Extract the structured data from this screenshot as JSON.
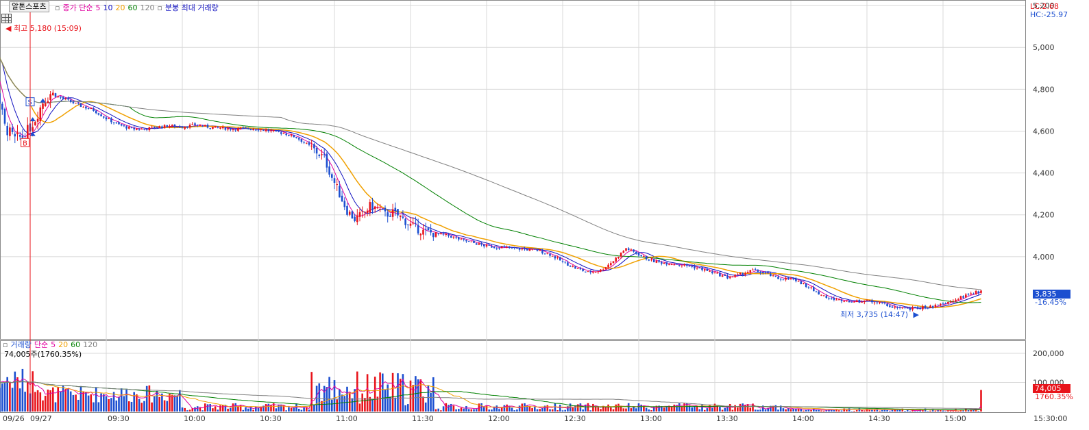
{
  "window": {
    "stock_tab": "알톤스포츠",
    "lc_label": "LC:2.68",
    "hc_label": "HC:-25.97"
  },
  "price_legend": {
    "marker": "▫",
    "label": "종가 단순",
    "periods": [
      "5",
      "10",
      "20",
      "60",
      "120"
    ],
    "period_colors": [
      "#e000a0",
      "#1010c0",
      "#f0a000",
      "#008000",
      "#808080"
    ],
    "extra": "분봉 최대 거래량"
  },
  "volume_legend": {
    "label": "거래량",
    "ma_label": "단순",
    "periods": [
      "5",
      "20",
      "60",
      "120"
    ],
    "period_colors": [
      "#e000a0",
      "#f0a000",
      "#008000",
      "#808080"
    ],
    "info": "74,005주(1760.35%)"
  },
  "annotations": {
    "high": "최고 5,180 (15:09)",
    "low": "최저 3,735 (14:47)",
    "buy_marker": "B",
    "sell_marker": "S"
  },
  "current": {
    "price": "3,835",
    "change": "-16.45%",
    "volume": "74,005",
    "volume_pct": "1760.35%"
  },
  "colors": {
    "up": "#e8141b",
    "down": "#1c4fd0",
    "grid": "#d8d8d8",
    "axis_text": "#333333",
    "price_box": "#1c4fd0",
    "volume_box": "#e8141b"
  },
  "chart_data": {
    "type": "candlestick",
    "price_axis": {
      "ticks": [
        "5,200",
        "5,000",
        "4,800",
        "4,600",
        "4,400",
        "4,200",
        "4,000"
      ],
      "ylim": [
        3610,
        5220
      ]
    },
    "volume_axis": {
      "ticks": [
        "200,000",
        "100,000"
      ],
      "ylim": [
        0,
        240000
      ]
    },
    "time_axis": {
      "labels": [
        "09/26",
        "09/27",
        "09:30",
        "10:00",
        "10:30",
        "11:00",
        "11:30",
        "12:00",
        "12:30",
        "13:00",
        "13:30",
        "14:00",
        "14:30",
        "15:00",
        "15:30:00"
      ],
      "minutes": [
        -20,
        0,
        30,
        60,
        90,
        120,
        150,
        180,
        210,
        240,
        270,
        300,
        330,
        360,
        390
      ]
    },
    "close_path": [
      [
        -20,
        5180
      ],
      [
        -16,
        4950
      ],
      [
        -13,
        4800
      ],
      [
        -10,
        4620
      ],
      [
        -6,
        4560
      ],
      [
        -2,
        4580
      ],
      [
        2,
        4660
      ],
      [
        5,
        4740
      ],
      [
        8,
        4780
      ],
      [
        12,
        4760
      ],
      [
        16,
        4740
      ],
      [
        20,
        4720
      ],
      [
        25,
        4700
      ],
      [
        30,
        4660
      ],
      [
        35,
        4630
      ],
      [
        40,
        4610
      ],
      [
        45,
        4610
      ],
      [
        50,
        4620
      ],
      [
        55,
        4625
      ],
      [
        60,
        4620
      ],
      [
        65,
        4630
      ],
      [
        70,
        4620
      ],
      [
        75,
        4615
      ],
      [
        80,
        4610
      ],
      [
        85,
        4612
      ],
      [
        90,
        4610
      ],
      [
        95,
        4600
      ],
      [
        100,
        4590
      ],
      [
        105,
        4570
      ],
      [
        110,
        4530
      ],
      [
        113,
        4500
      ],
      [
        116,
        4470
      ],
      [
        119,
        4380
      ],
      [
        122,
        4300
      ],
      [
        125,
        4220
      ],
      [
        128,
        4180
      ],
      [
        131,
        4200
      ],
      [
        134,
        4240
      ],
      [
        137,
        4230
      ],
      [
        140,
        4200
      ],
      [
        143,
        4210
      ],
      [
        146,
        4190
      ],
      [
        150,
        4150
      ],
      [
        155,
        4120
      ],
      [
        160,
        4110
      ],
      [
        165,
        4100
      ],
      [
        170,
        4080
      ],
      [
        175,
        4065
      ],
      [
        180,
        4050
      ],
      [
        185,
        4045
      ],
      [
        190,
        4040
      ],
      [
        195,
        4035
      ],
      [
        200,
        4030
      ],
      [
        205,
        4010
      ],
      [
        210,
        3975
      ],
      [
        215,
        3945
      ],
      [
        220,
        3925
      ],
      [
        225,
        3935
      ],
      [
        230,
        3980
      ],
      [
        235,
        4040
      ],
      [
        240,
        4010
      ],
      [
        245,
        3980
      ],
      [
        250,
        3970
      ],
      [
        255,
        3965
      ],
      [
        260,
        3955
      ],
      [
        265,
        3940
      ],
      [
        270,
        3920
      ],
      [
        275,
        3900
      ],
      [
        280,
        3915
      ],
      [
        285,
        3935
      ],
      [
        290,
        3920
      ],
      [
        295,
        3895
      ],
      [
        300,
        3895
      ],
      [
        305,
        3870
      ],
      [
        310,
        3830
      ],
      [
        315,
        3800
      ],
      [
        320,
        3790
      ],
      [
        325,
        3785
      ],
      [
        330,
        3790
      ],
      [
        335,
        3780
      ],
      [
        340,
        3760
      ],
      [
        345,
        3750
      ],
      [
        350,
        3755
      ],
      [
        355,
        3760
      ],
      [
        360,
        3770
      ],
      [
        365,
        3795
      ],
      [
        370,
        3820
      ],
      [
        375,
        3835
      ]
    ],
    "series": [
      {
        "name": "5",
        "values": []
      },
      {
        "name": "10",
        "values": []
      },
      {
        "name": "20",
        "values": []
      },
      {
        "name": "60",
        "values": []
      },
      {
        "name": "120",
        "values": []
      }
    ],
    "high": {
      "value": 5180,
      "time": "15:09"
    },
    "low": {
      "value": 3735,
      "time": "14:47"
    },
    "last": 3835
  }
}
